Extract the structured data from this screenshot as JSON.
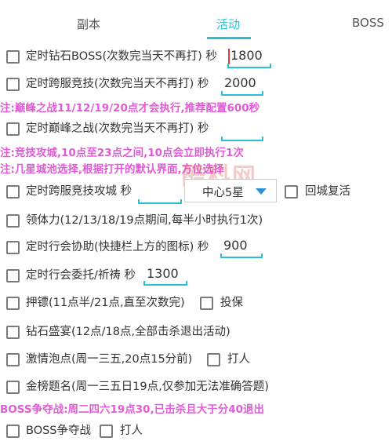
{
  "tabs": [
    {
      "label": "副本",
      "active": false
    },
    {
      "label": "活动",
      "active": true
    },
    {
      "label": "BOSS",
      "active": false
    }
  ],
  "rows": {
    "boss_diamond": {
      "label": "定时钻石BOSS(次数完当天不再打) 秒",
      "value": "1800"
    },
    "cross_server_arena": {
      "label": "定时跨服竞技(次数完当天不再打) 秒",
      "value": "2000"
    },
    "peak_note": "注:巅峰之战11/12/19/20点才会执行,推荐配置600秒",
    "peak_battle": {
      "label": "定时巅峰之战(次数完当天不再打) 秒",
      "value": ""
    },
    "siege_note_1": "注:竞技攻城,10点至23点之间,10点会立即执行1次",
    "siege_note_2": "注:几星城池选择,根据打开的默认界面,方位选择",
    "cross_siege": {
      "label": "定时跨服竞技攻城 秒",
      "value": "",
      "dropdown": "中心5星",
      "return_label": "回城复活"
    },
    "stamina": {
      "label": "领体力(12/13/18/19点期间,每半小时执行1次)"
    },
    "guild_help": {
      "label": "定时行会协助(快捷栏上方的图标) 秒",
      "value": "900"
    },
    "guild_commission": {
      "label": "定时行会委托/祈祷 秒",
      "value": "1300"
    },
    "escort": {
      "label": "押镖(11点半/21点,直至次数完)",
      "insure_label": "投保"
    },
    "diamond_feast": {
      "label": "钻石盛宴(12点/18点,全部击杀退出活动)"
    },
    "hot_spring": {
      "label": "激情泡点(周一三五,20点15分前)",
      "fight_label": "打人"
    },
    "gold_list": {
      "label": "金榜题名(周一三五日19点,仅参加无法准确答题)"
    },
    "boss_contest_note": "BOSS争夺战:周二四六19点30,已击杀且大于分40退出",
    "boss_contest": {
      "label": "BOSS争夺战",
      "fight_label": "打人"
    }
  },
  "watermark": "酷科网"
}
